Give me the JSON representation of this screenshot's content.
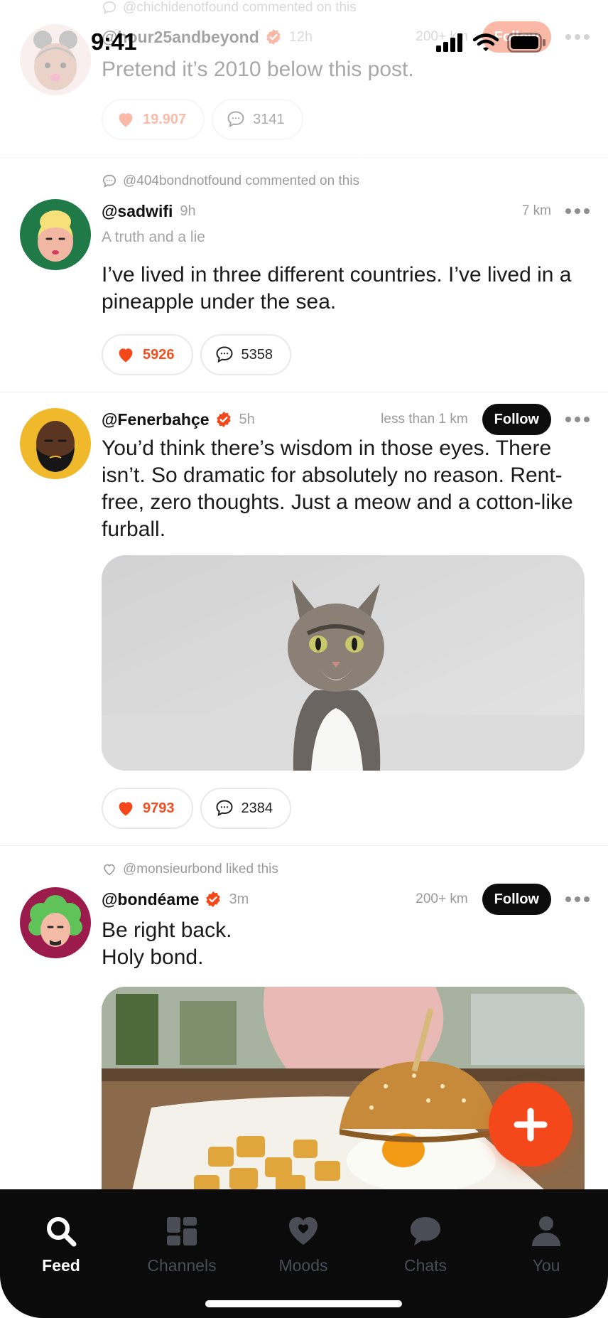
{
  "status_bar": {
    "time": "9:41"
  },
  "posts": [
    {
      "context": "@chichidenotfound commented on this",
      "handle": "@hour25andbeyond",
      "time": "12h",
      "distance": "200+ km",
      "follow_label": "Follow",
      "body": "Pretend it’s 2010 below this post.",
      "likes": "19.907",
      "comments": "3141"
    },
    {
      "context": "@404bondnotfound commented on this",
      "handle": "@sadwifi",
      "time": "9h",
      "distance": "7 km",
      "subtitle": "A truth and a lie",
      "body": "I’ve lived in three different countries. I’ve lived in a pineapple under the sea.",
      "likes": "5926",
      "comments": "5358"
    },
    {
      "handle": "@Fenerbahçe",
      "time": "5h",
      "distance": "less than 1 km",
      "follow_label": "Follow",
      "body": "You’d think there’s wisdom in those eyes. There isn’t. So dramatic for absolutely no reason. Rent-free, zero thoughts. Just a meow and a cotton-like furball.",
      "likes": "9793",
      "comments": "2384"
    },
    {
      "context": "@monsieurbond liked this",
      "handle": "@bondéame",
      "time": "3m",
      "distance": "200+ km",
      "follow_label": "Follow",
      "body_line1": "Be right back.",
      "body_line2": "Holy bond."
    }
  ],
  "tabs": [
    {
      "label": "Feed",
      "icon": "search-icon",
      "active": true
    },
    {
      "label": "Channels",
      "icon": "grid-icon",
      "active": false
    },
    {
      "label": "Moods",
      "icon": "heart-icon",
      "active": false
    },
    {
      "label": "Chats",
      "icon": "chat-bubble-icon",
      "active": false
    },
    {
      "label": "You",
      "icon": "person-icon",
      "active": false
    }
  ],
  "colors": {
    "accent": "#f4481b",
    "tabbar": "#0b0b0c",
    "inactive_tab": "#4a4d55"
  }
}
